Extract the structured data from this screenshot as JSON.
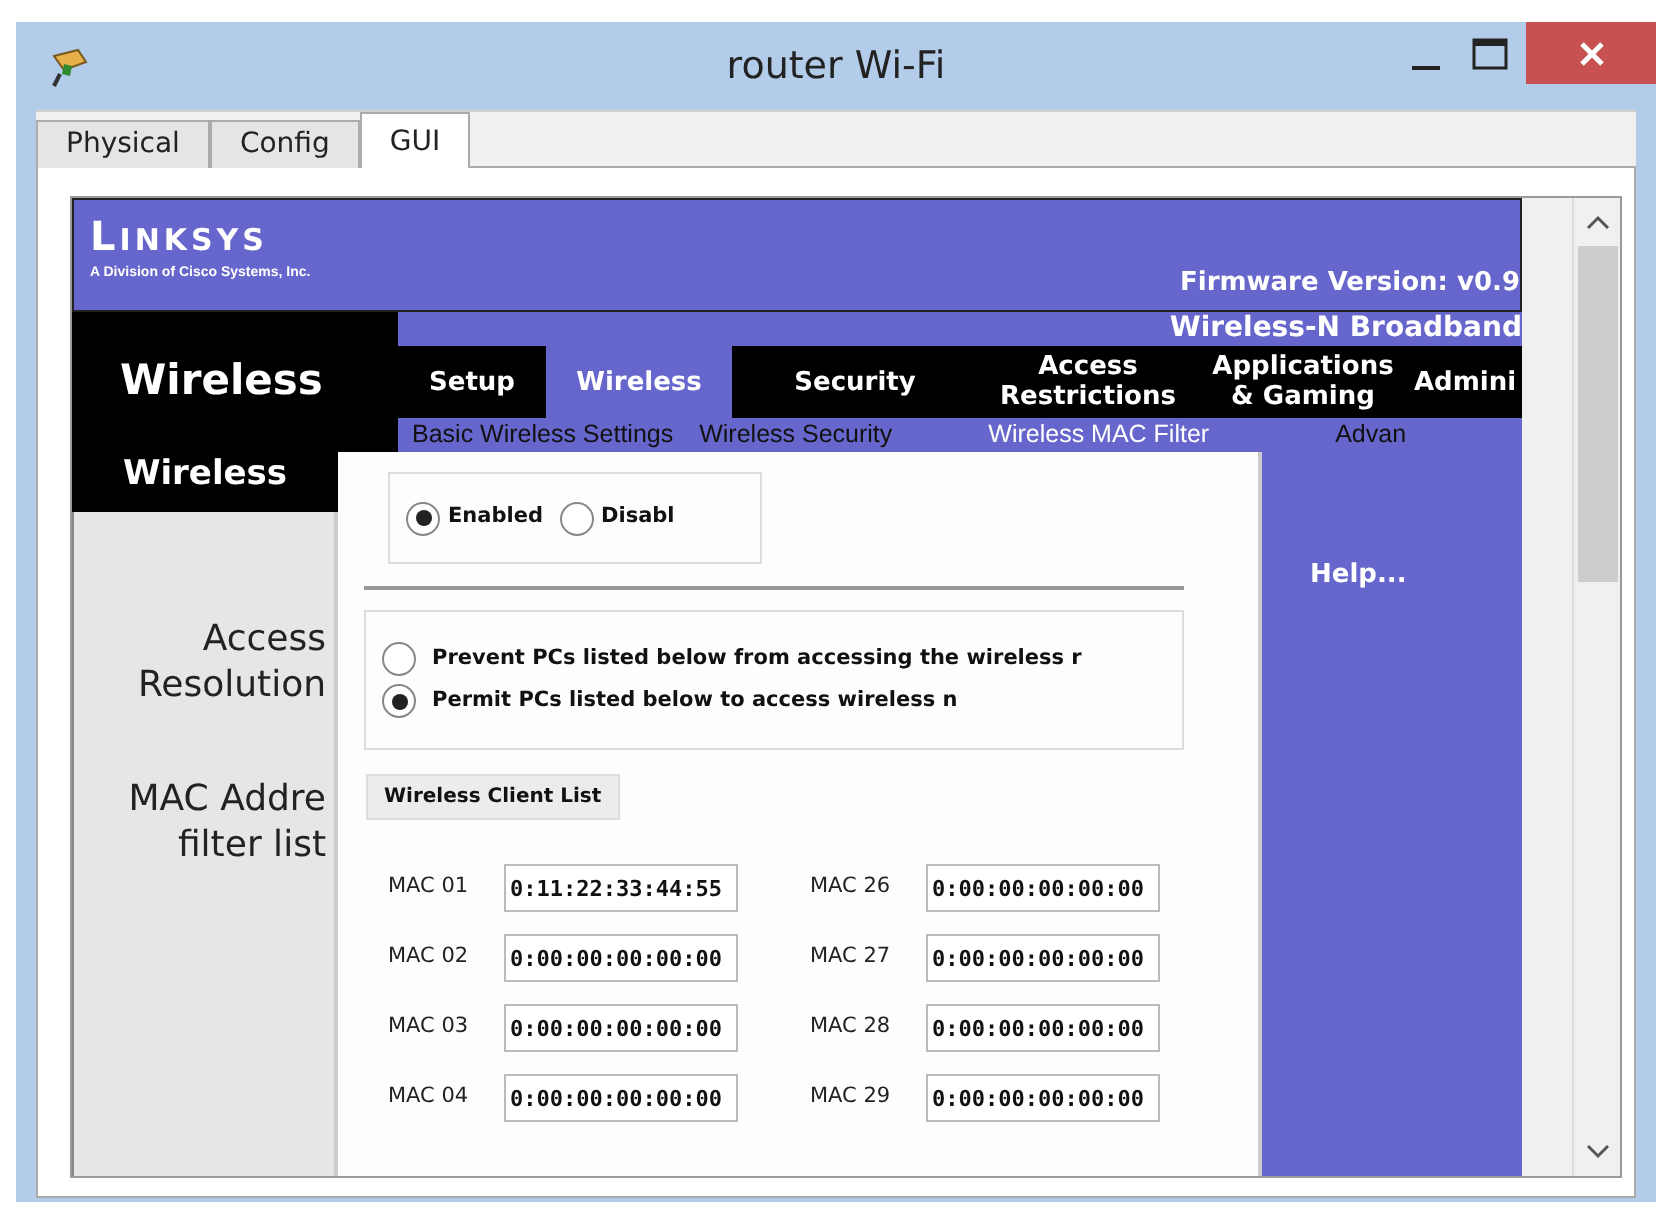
{
  "window": {
    "title": "router Wi-Fi"
  },
  "tabs": [
    {
      "label": "Physical",
      "selected": false
    },
    {
      "label": "Config",
      "selected": false
    },
    {
      "label": "GUI",
      "selected": true
    }
  ],
  "page": {
    "logo": {
      "brand": "LINKSYS",
      "tagline": "A Division of Cisco Systems, Inc."
    },
    "firmware": "Firmware Version: v0.9",
    "product": "Wireless-N Broadband",
    "section": "Wireless",
    "menu": [
      {
        "label": "Setup",
        "selected": false
      },
      {
        "label": "Wireless",
        "selected": true
      },
      {
        "label": "Security",
        "selected": false
      },
      {
        "label": "Access Restrictions",
        "selected": false
      },
      {
        "label": "Applications & Gaming",
        "selected": false
      },
      {
        "label": "Admini",
        "selected": false
      }
    ],
    "submenu": [
      {
        "label": "Basic Wireless Settings",
        "selected": false
      },
      {
        "label": "Wireless Security",
        "selected": false
      },
      {
        "label": "Wireless MAC Filter",
        "selected": true
      },
      {
        "label": "Advan",
        "selected": false
      }
    ],
    "subsection": "Wireless",
    "row_labels": [
      {
        "lines": [
          "Access",
          "Resolution"
        ]
      },
      {
        "lines": [
          "MAC Addre",
          "filter list"
        ]
      }
    ],
    "filter_state": [
      {
        "label": "Enabled",
        "selected": true
      },
      {
        "label": "Disabl",
        "selected": false
      }
    ],
    "access_mode": [
      {
        "label": "Prevent PCs listed below from accessing the wireless r",
        "selected": false
      },
      {
        "label": "Permit PCs listed below to access wireless n",
        "selected": true
      }
    ],
    "client_list_button": "Wireless Client List",
    "mac_columns": [
      [
        {
          "label": "MAC 01",
          "value": "0:11:22:33:44:55"
        },
        {
          "label": "MAC 02",
          "value": "0:00:00:00:00:00"
        },
        {
          "label": "MAC 03",
          "value": "0:00:00:00:00:00"
        },
        {
          "label": "MAC 04",
          "value": "0:00:00:00:00:00"
        }
      ],
      [
        {
          "label": "MAC 26",
          "value": "0:00:00:00:00:00"
        },
        {
          "label": "MAC 27",
          "value": "0:00:00:00:00:00"
        },
        {
          "label": "MAC 28",
          "value": "0:00:00:00:00:00"
        },
        {
          "label": "MAC 29",
          "value": "0:00:00:00:00:00"
        }
      ]
    ],
    "help": "Help..."
  }
}
